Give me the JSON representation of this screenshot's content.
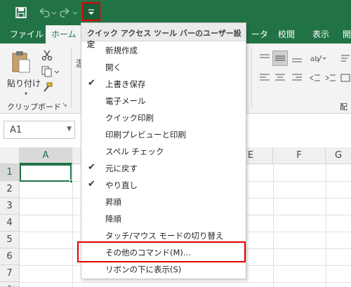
{
  "qat": {
    "save_icon": "save-icon",
    "undo_icon": "undo-icon",
    "redo_icon": "redo-icon",
    "customize_icon": "customize-qat-dropdown-icon"
  },
  "ribbon_tabs": {
    "file": "ファイル",
    "home": "ホーム",
    "data_partial": "ータ",
    "review": "校閲",
    "view": "表示",
    "partial_right": "開"
  },
  "ribbon": {
    "paste_label": "貼り付け",
    "clipboard_group": "クリップボード",
    "right_group_partial": "配",
    "font_box_partial": "游"
  },
  "namebox": {
    "value": "A1"
  },
  "grid": {
    "columns": [
      "A",
      "E",
      "F",
      "G"
    ],
    "rows": [
      "1",
      "2",
      "3",
      "4",
      "5",
      "6",
      "7",
      "8"
    ]
  },
  "menu": {
    "header": "クイック アクセス ツール バーのユーザー設定",
    "items": [
      {
        "label": "新規作成",
        "checked": false
      },
      {
        "label": "開く",
        "checked": false
      },
      {
        "label": "上書き保存",
        "checked": true
      },
      {
        "label": "電子メール",
        "checked": false
      },
      {
        "label": "クイック印刷",
        "checked": false
      },
      {
        "label": "印刷プレビューと印刷",
        "checked": false
      },
      {
        "label": "スペル チェック",
        "checked": false
      },
      {
        "label": "元に戻す",
        "checked": true
      },
      {
        "label": "やり直し",
        "checked": true
      },
      {
        "label": "昇順",
        "checked": false
      },
      {
        "label": "降順",
        "checked": false
      },
      {
        "label": "タッチ/マウス モードの切り替え",
        "checked": false
      },
      {
        "label": "その他のコマンド(M)...",
        "checked": false
      },
      {
        "label": "リボンの下に表示(S)",
        "checked": false
      }
    ],
    "check_glyph": "✔"
  },
  "colors": {
    "excel_green": "#217346",
    "highlight_red": "#e00000"
  }
}
